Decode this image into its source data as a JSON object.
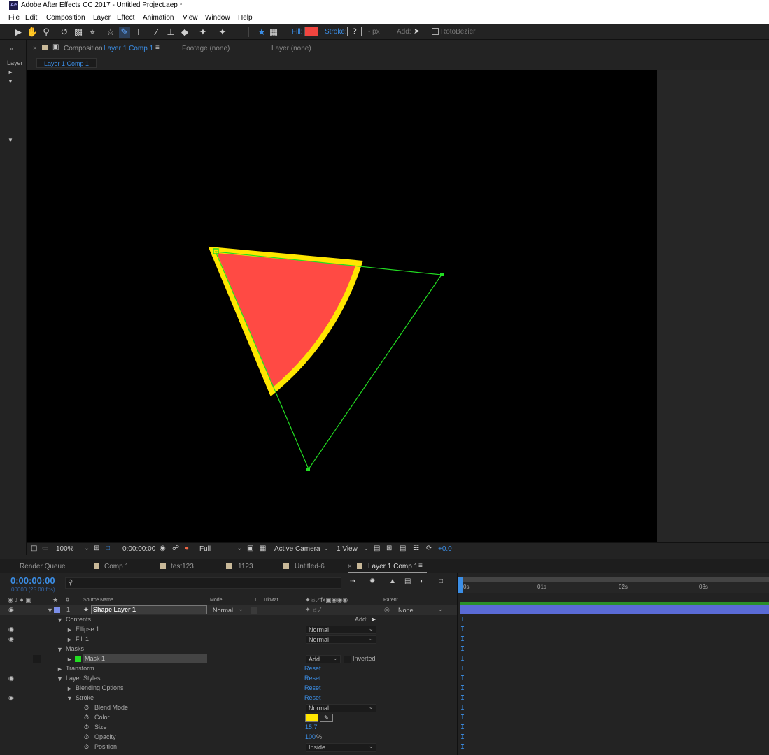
{
  "app": {
    "logo": "Ae",
    "title": "Adobe After Effects CC 2017 - Untitled Project.aep *"
  },
  "menu": [
    "File",
    "Edit",
    "Composition",
    "Layer",
    "Effect",
    "Animation",
    "View",
    "Window",
    "Help"
  ],
  "toolbar": {
    "fill_label": "Fill:",
    "fill_color": "#f0453f",
    "stroke_label": "Stroke:",
    "stroke_value": "?",
    "stroke_px": "- px",
    "add_label": "Add:",
    "rotobezier_label": "RotoBezier"
  },
  "left_panel": {
    "label": "Layer"
  },
  "comp_panel": {
    "prefix": "Composition",
    "comp_name": "Layer 1 Comp 1",
    "footage_tab": "Footage (none)",
    "layer_tab": "Layer (none)",
    "subtab": "Layer 1 Comp 1"
  },
  "viewer_bar": {
    "zoom": "100%",
    "timecode": "0:00:00:00",
    "resolution": "Full",
    "camera": "Active Camera",
    "views": "1 View",
    "exposure": "+0.0"
  },
  "bottom_tabs": {
    "render_queue": "Render Queue",
    "tabs": [
      "Comp 1",
      "test123",
      "1123",
      "Untitled-6",
      "Layer 1 Comp 1"
    ],
    "active_index": 4
  },
  "timeline": {
    "timecode": "0:00:00:00",
    "fps": "00000 (25.00 fps)",
    "columns": {
      "num": "#",
      "source": "Source Name",
      "mode": "Mode",
      "t": "T",
      "trkmat": "TrkMat",
      "parent": "Parent"
    },
    "ruler": [
      "0s",
      "01s",
      "02s",
      "03s"
    ],
    "layer": {
      "num": "1",
      "name": "Shape Layer 1",
      "mode": "Normal",
      "parent": "None"
    },
    "rows": {
      "contents": "Contents",
      "add": "Add:",
      "ellipse": "Ellipse 1",
      "ellipse_mode": "Normal",
      "fill": "Fill 1",
      "fill_mode": "Normal",
      "masks": "Masks",
      "mask": "Mask 1",
      "mask_mode": "Add",
      "inverted": "Inverted",
      "transform": "Transform",
      "transform_reset": "Reset",
      "layer_styles": "Layer Styles",
      "layer_styles_reset": "Reset",
      "blending": "Blending Options",
      "blending_reset": "Reset",
      "stroke": "Stroke",
      "stroke_reset": "Reset",
      "blend_mode": "Blend Mode",
      "blend_mode_value": "Normal",
      "color": "Color",
      "color_value": "#ffe600",
      "size": "Size",
      "size_value": "15.7",
      "opacity": "Opacity",
      "opacity_value": "100",
      "opacity_unit": "%",
      "position": "Position",
      "position_value": "Inside"
    }
  },
  "canvas": {
    "shape_fill": "#ff4a44",
    "shape_stroke": "#ffe600",
    "mask_path_color": "#22dd22"
  }
}
